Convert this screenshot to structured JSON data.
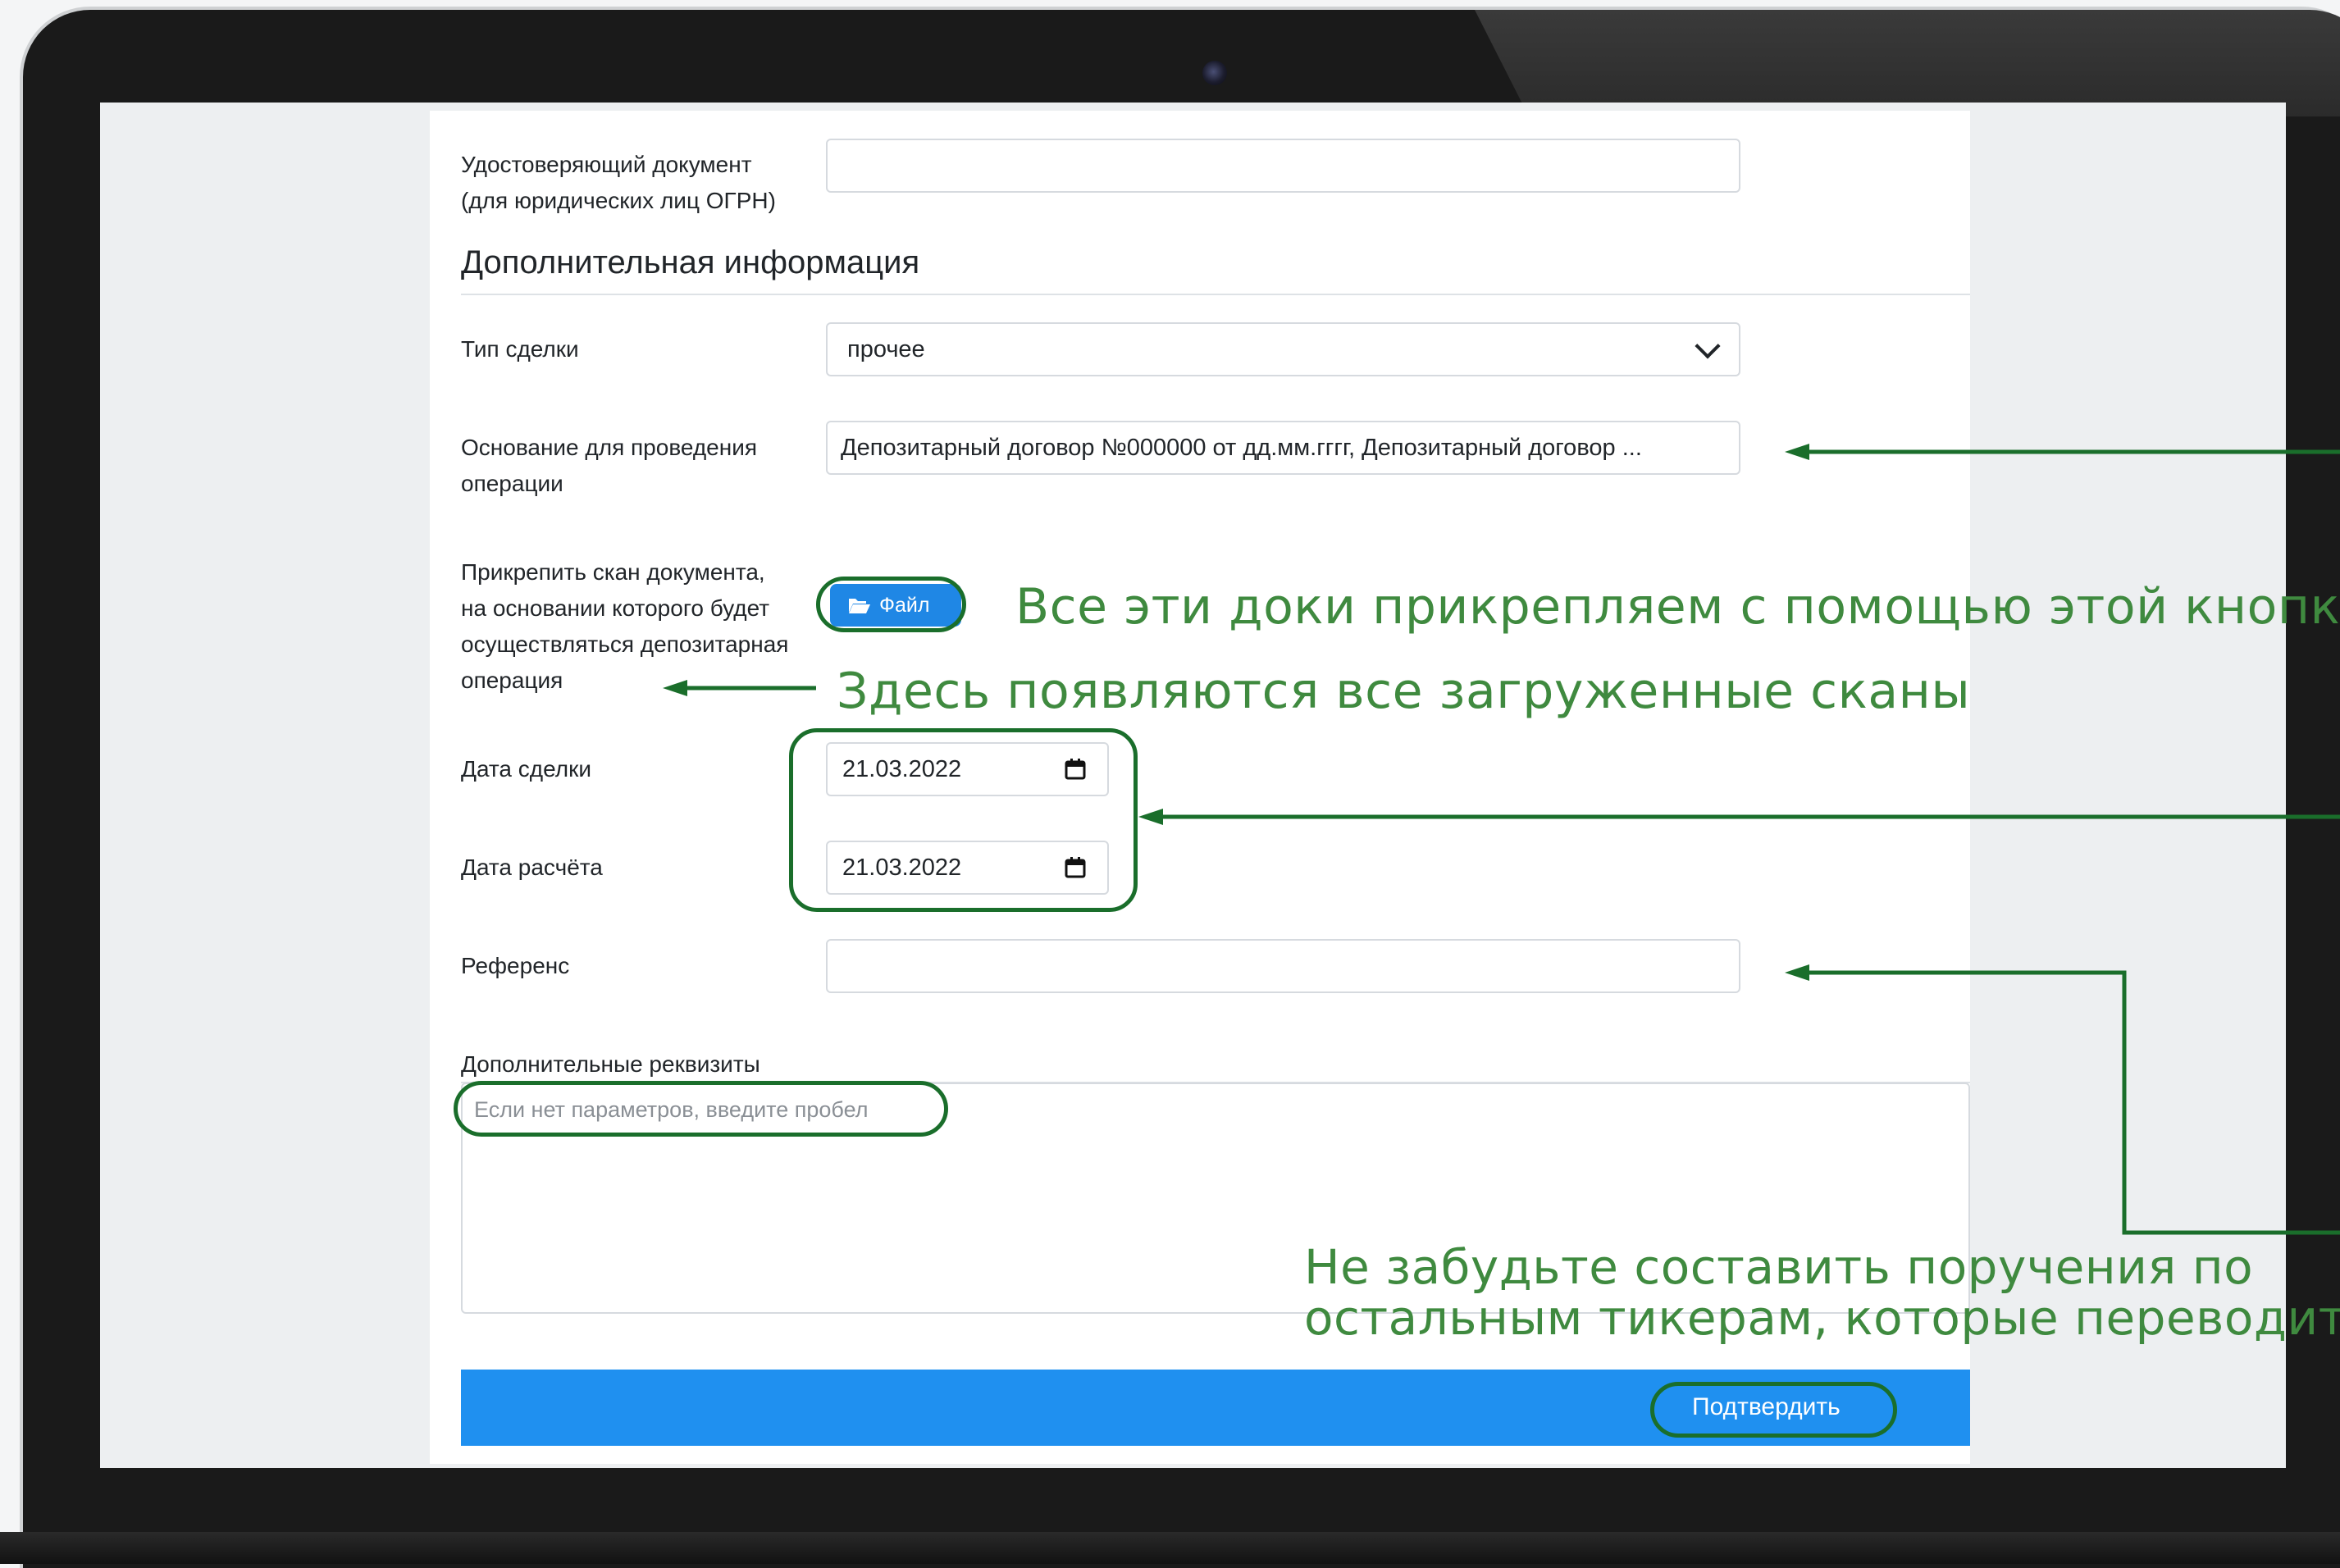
{
  "form": {
    "id_doc_label_line1": "Удостоверяющий документ",
    "id_doc_label_line2": "(для юридических лиц ОГРН)",
    "id_doc_value": "",
    "section_title": "Дополнительная информация",
    "deal_type_label": "Тип сделки",
    "deal_type_value": "прочее",
    "basis_label_line1": "Основание для проведения",
    "basis_label_line2": "операции",
    "basis_value": "Депозитарный договор №000000 от дд.мм.гггг, Депозитарный договор ...",
    "attach_label_line1": "Прикрепить скан документа,",
    "attach_label_line2": "на основании которого будет",
    "attach_label_line3": "осуществляться депозитарная",
    "attach_label_line4": "операция",
    "file_button_label": "Файл",
    "deal_date_label": "Дата сделки",
    "deal_date_value": "21.03.2022",
    "settle_date_label": "Дата расчёта",
    "settle_date_value": "21.03.2022",
    "reference_label": "Референс",
    "reference_value": "",
    "extra_label": "Дополнительные реквизиты",
    "extra_placeholder": "Если нет параметров, введите пробел",
    "submit_label": "Подтвердить"
  },
  "annotations": {
    "attach_note": "Все эти доки прикрепляем с помощью этой кнопки!",
    "scans_note": "Здесь появляются все загруженные сканы",
    "reminder_line1": "Не забудьте составить поручения по",
    "reminder_line2": "остальным тикерам, которые переводите"
  },
  "icons": {
    "folder": "folder-open-icon",
    "calendar": "calendar-icon",
    "dropdown": "chevron-down-icon",
    "webcam": "camera-icon"
  },
  "colors": {
    "accent_blue": "#1f90f0",
    "file_button_blue": "#1f87e5",
    "annotation_green": "#3f8a3f",
    "ring_green": "#1a6e2b"
  }
}
